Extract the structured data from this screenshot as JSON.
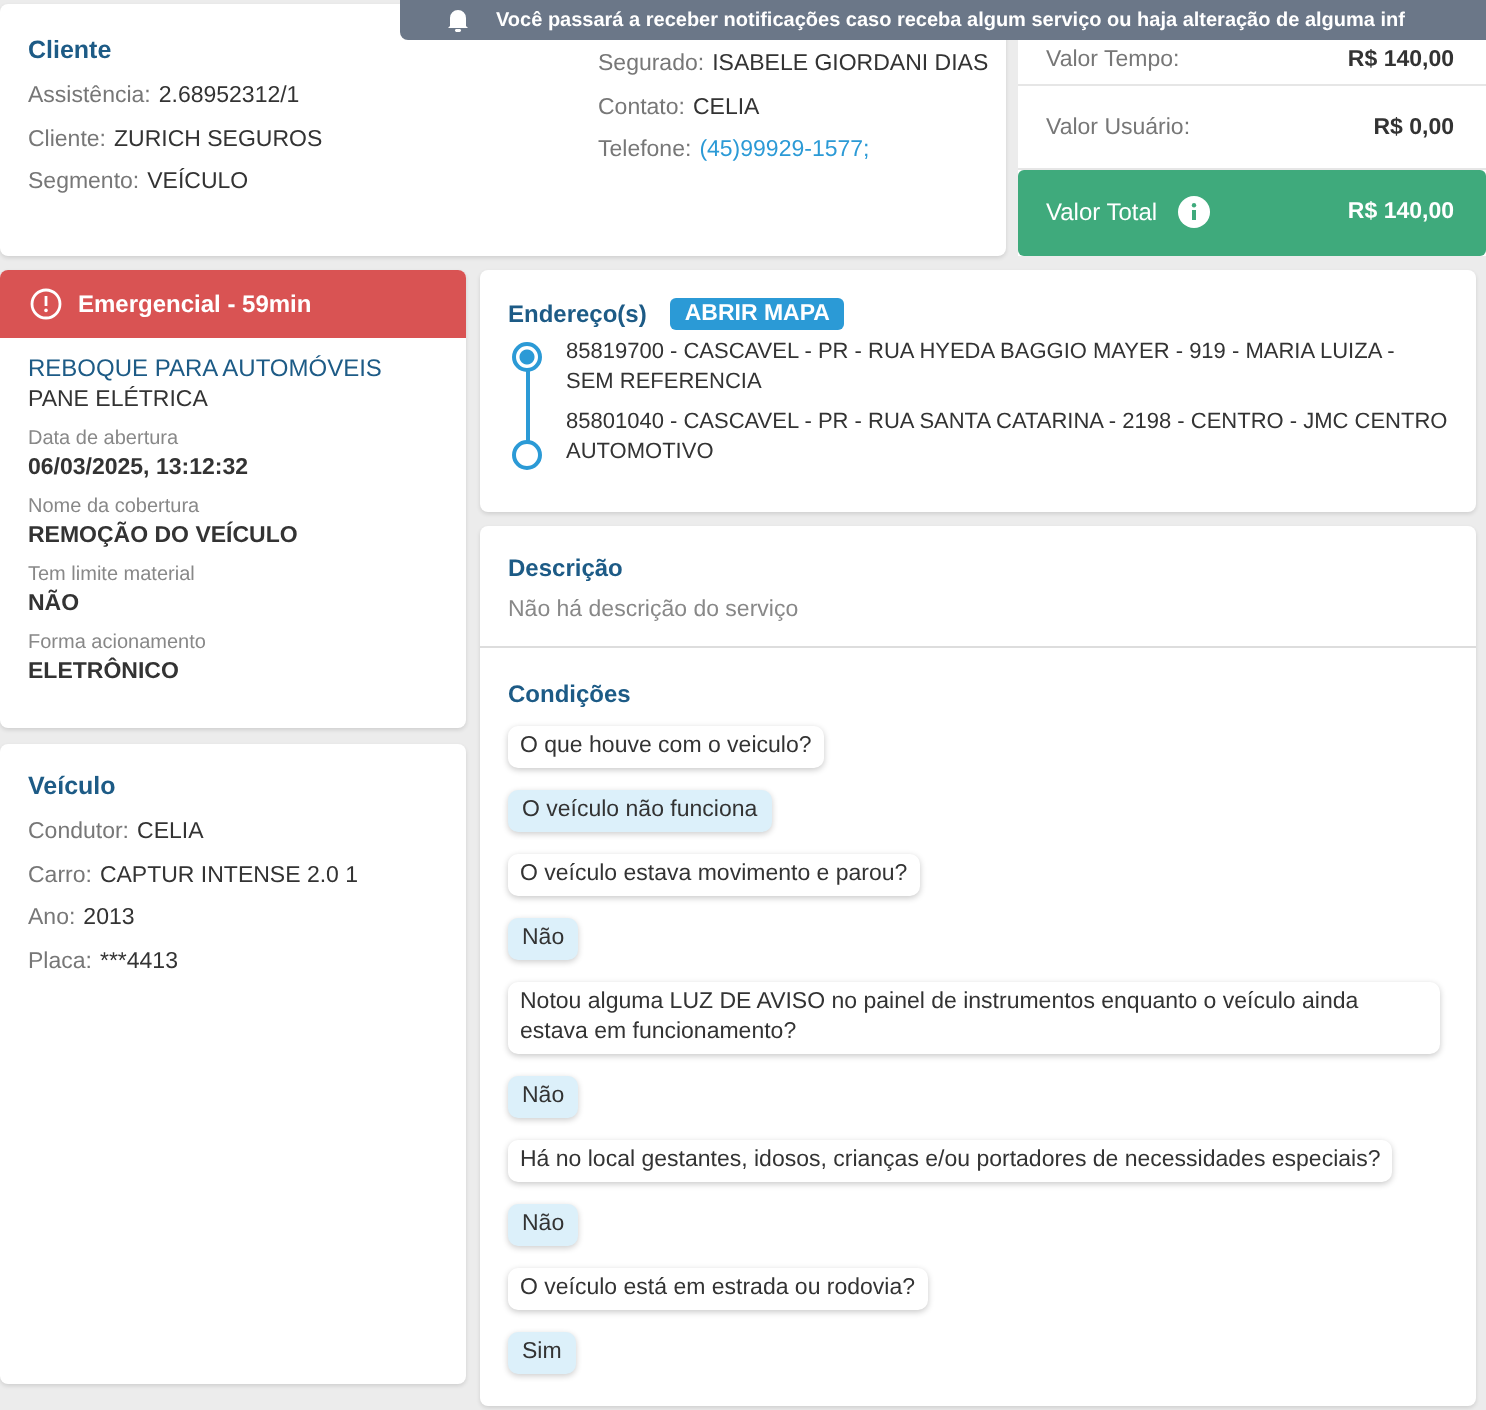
{
  "toast": {
    "text": "Você passará a receber notificações caso receba algum serviço ou haja alteração de alguma inf"
  },
  "cliente": {
    "title": "Cliente",
    "fields": [
      {
        "label": "Assistência:",
        "value": "2.68952312/1",
        "kind": "text"
      },
      {
        "label": "Cliente:",
        "value": "ZURICH SEGUROS",
        "kind": "text"
      },
      {
        "label": "Segmento:",
        "value": "VEÍCULO",
        "kind": "text"
      },
      {
        "label": "Segurado:",
        "value": "ISABELE GIORDANI DIAS",
        "kind": "text"
      },
      {
        "label": "Contato:",
        "value": "CELIA",
        "kind": "text"
      },
      {
        "label": "Telefone:",
        "value": "(45)99929-1577;",
        "kind": "link"
      }
    ]
  },
  "valores": [
    {
      "label": "Valor Tempo:",
      "value": "R$ 140,00",
      "kind": "plain"
    },
    {
      "label": "Valor Usuário:",
      "value": "R$ 0,00",
      "kind": "plain"
    },
    {
      "label": "Valor Total",
      "value": "R$ 140,00",
      "kind": "total"
    }
  ],
  "servico": {
    "badge": "Emergencial - 59min",
    "title": "REBOQUE PARA AUTOMÓVEIS",
    "subtitle": "PANE ELÉTRICA",
    "fields": [
      {
        "label": "Data de abertura",
        "value": "06/03/2025, 13:12:32"
      },
      {
        "label": "Nome da cobertura",
        "value": "REMOÇÃO DO VEÍCULO"
      },
      {
        "label": "Tem limite material",
        "value": "NÃO"
      },
      {
        "label": "Forma acionamento",
        "value": "ELETRÔNICO"
      }
    ]
  },
  "veiculo": {
    "title": "Veículo",
    "fields": [
      {
        "label": "Condutor:",
        "value": "CELIA"
      },
      {
        "label": "Carro:",
        "value": "CAPTUR INTENSE 2.0 1"
      },
      {
        "label": "Ano:",
        "value": "2013"
      },
      {
        "label": "Placa:",
        "value": "***4413"
      }
    ]
  },
  "enderecos": {
    "title": "Endereço(s)",
    "button": "ABRIR MAPA",
    "items": [
      {
        "text": "85819700 - CASCAVEL - PR - RUA HYEDA BAGGIO MAYER - 919 - MARIA LUIZA - SEM REFERENCIA",
        "selected": true
      },
      {
        "text": "85801040 - CASCAVEL - PR - RUA SANTA CATARINA - 2198 - CENTRO - JMC CENTRO AUTOMOTIVO",
        "selected": false
      }
    ]
  },
  "descricao": {
    "title": "Descrição",
    "text": "Não há descrição do serviço"
  },
  "condicoes": {
    "title": "Condições",
    "items": [
      {
        "kind": "question",
        "text": "O que houve com o veiculo?"
      },
      {
        "kind": "answer",
        "text": "O veículo não funciona"
      },
      {
        "kind": "question",
        "text": "O veículo estava movimento e parou?"
      },
      {
        "kind": "answer",
        "text": "Não"
      },
      {
        "kind": "question",
        "text": "Notou alguma LUZ DE AVISO no painel de instrumentos enquanto o veículo ainda estava em funcionamento?"
      },
      {
        "kind": "answer",
        "text": "Não"
      },
      {
        "kind": "question",
        "text": "Há no local gestantes, idosos, crianças e/ou portadores de necessidades especiais?"
      },
      {
        "kind": "answer",
        "text": "Não"
      },
      {
        "kind": "question",
        "text": "O veículo está em estrada ou rodovia?"
      },
      {
        "kind": "answer",
        "text": "Sim"
      }
    ]
  }
}
